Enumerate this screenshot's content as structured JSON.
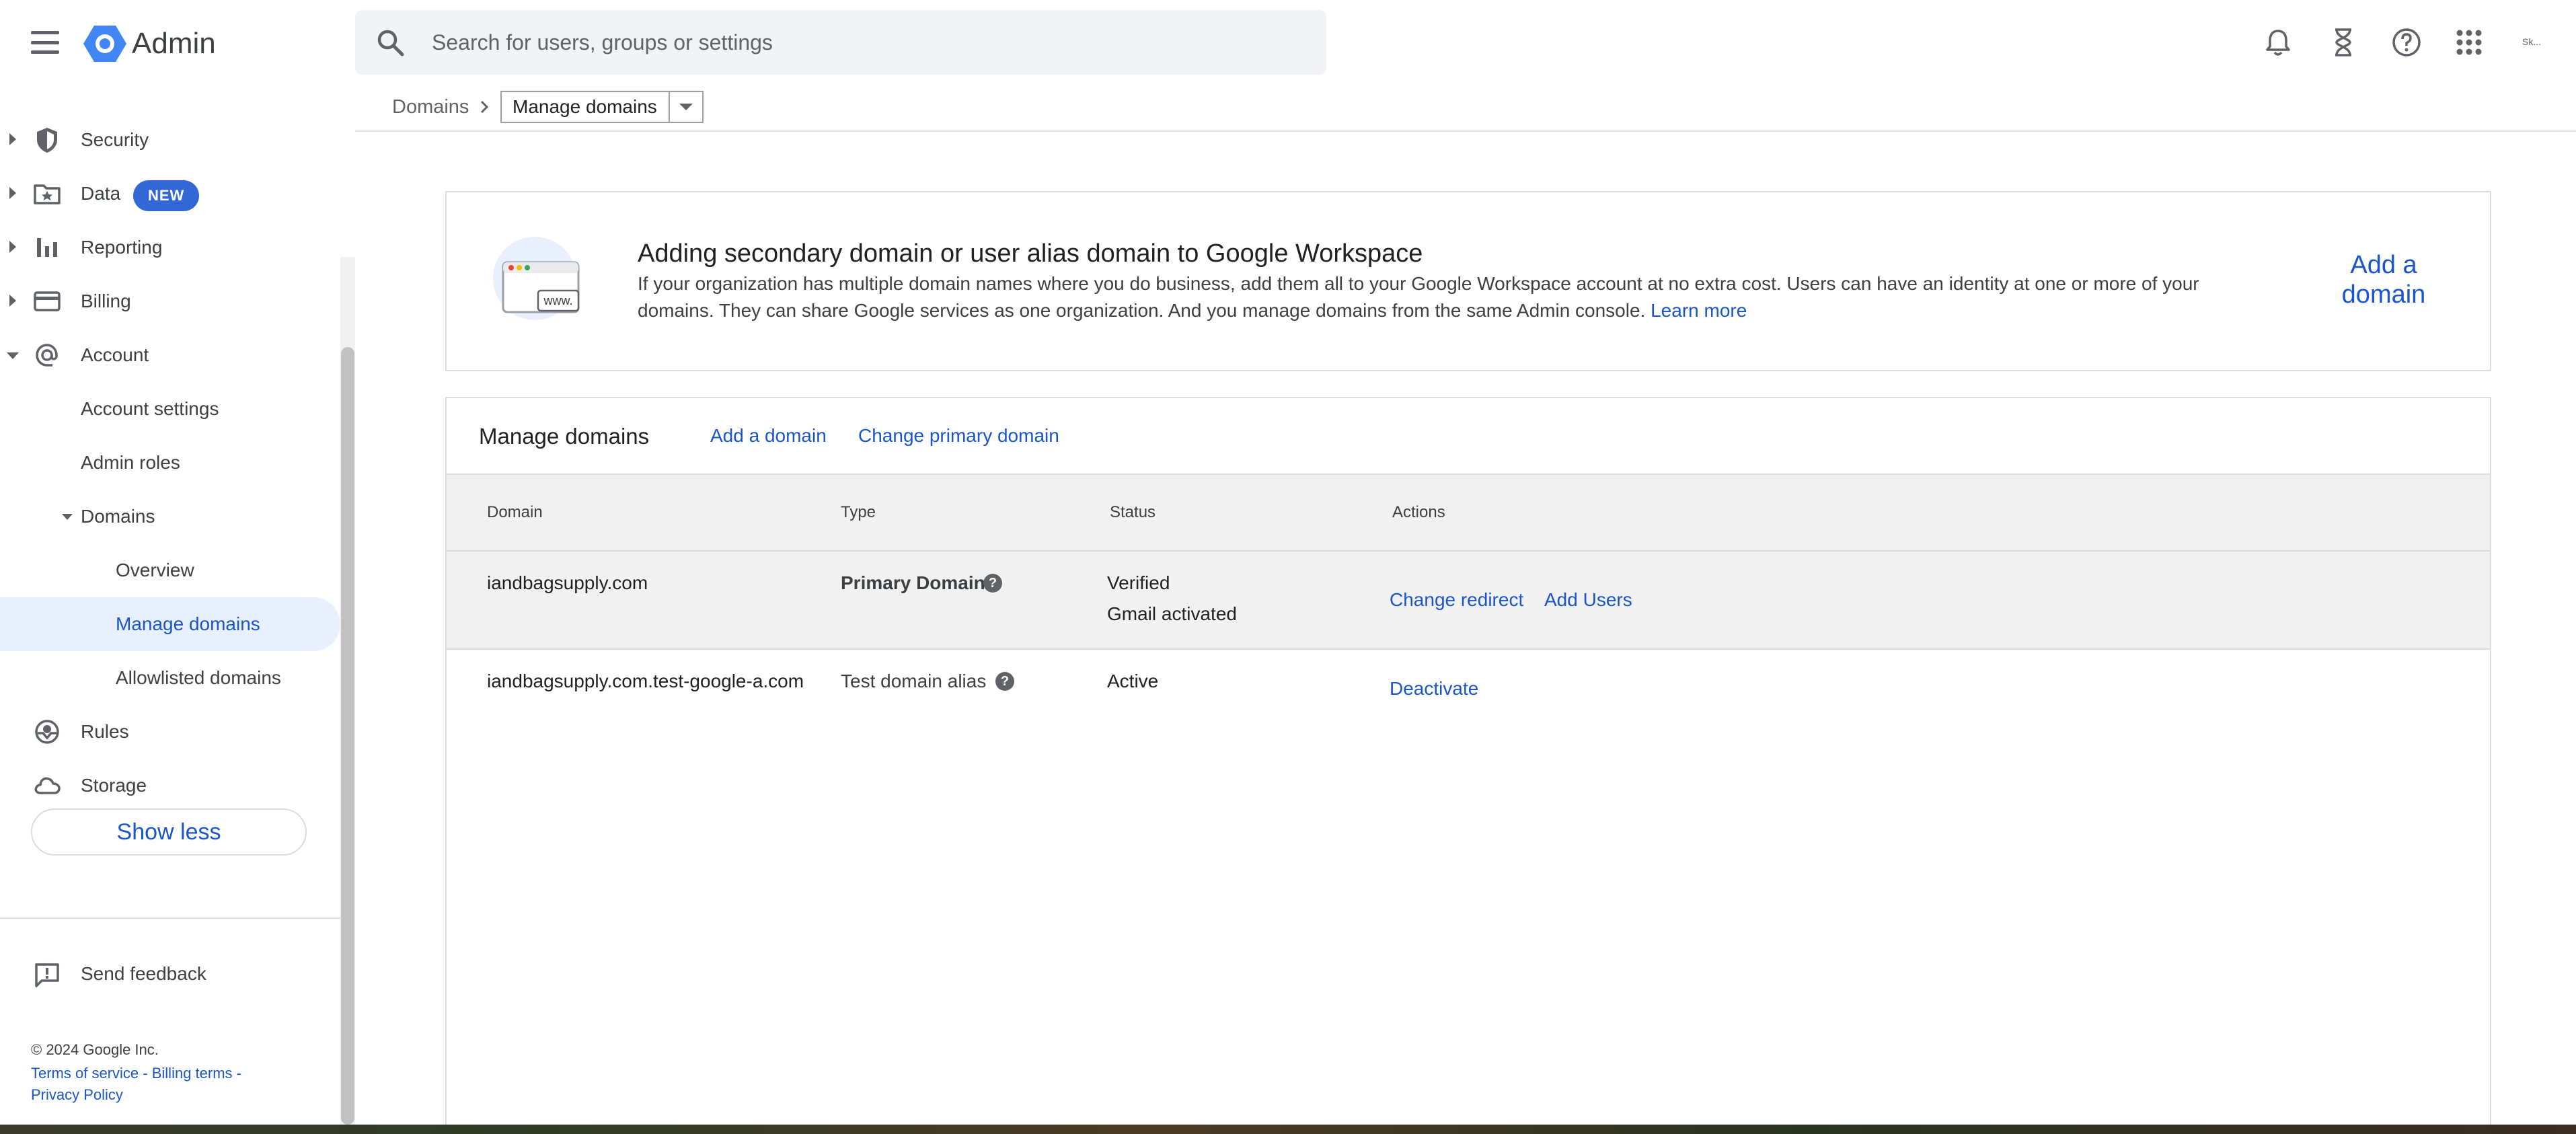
{
  "header": {
    "app_title": "Admin",
    "search_placeholder": "Search for users, groups or settings",
    "icons": [
      "menu-icon",
      "admin-logo",
      "search-icon",
      "notifications-icon",
      "tasks-hourglass-icon",
      "help-icon",
      "apps-grid-icon",
      "account-avatar"
    ],
    "avatar_text": "Sk..."
  },
  "breadcrumb": {
    "parent": "Domains",
    "current": "Manage domains"
  },
  "sidebar": {
    "items": [
      {
        "label": "Security",
        "icon": "shield-icon"
      },
      {
        "label": "Data",
        "icon": "folder-star-icon",
        "badge": "NEW"
      },
      {
        "label": "Reporting",
        "icon": "bar-chart-icon"
      },
      {
        "label": "Billing",
        "icon": "credit-card-icon"
      },
      {
        "label": "Account",
        "icon": "at-sign-icon"
      },
      {
        "label": "Account settings"
      },
      {
        "label": "Admin roles"
      },
      {
        "label": "Domains"
      },
      {
        "label": "Overview"
      },
      {
        "label": "Manage domains",
        "active": true
      },
      {
        "label": "Allowlisted domains"
      },
      {
        "label": "Rules",
        "icon": "rules-icon"
      },
      {
        "label": "Storage",
        "icon": "cloud-icon"
      }
    ],
    "show_less": "Show less",
    "send_feedback": "Send feedback",
    "copyright": "© 2024 Google Inc.",
    "footer_links": {
      "terms": "Terms of service",
      "billing": "Billing terms",
      "privacy": "Privacy Policy",
      "sep": "-"
    }
  },
  "info_card": {
    "title": "Adding secondary domain or user alias domain to Google Workspace",
    "body": "If your organization has multiple domain names where you do business, add them all to your Google Workspace account at no extra cost. Users can have an identity at one or more of your domains. They can share Google services as one organization. And you manage domains from the same Admin console.",
    "learn_more": "Learn more",
    "add_domain": "Add a domain",
    "illustration_text": "www."
  },
  "table": {
    "title": "Manage domains",
    "links": [
      "Add a domain",
      "Change primary domain"
    ],
    "columns": [
      "Domain",
      "Type",
      "Status",
      "Actions"
    ],
    "rows": [
      {
        "domain": "iandbagsupply.com",
        "type": "Primary Domain",
        "status": [
          "Verified",
          "Gmail activated"
        ],
        "actions": [
          "Change redirect",
          "Add Users"
        ]
      },
      {
        "domain": "iandbagsupply.com.test-google-a.com",
        "type": "Test domain alias",
        "status": [
          "Active"
        ],
        "actions": [
          "Deactivate"
        ]
      }
    ],
    "help_glyph": "?"
  },
  "colors": {
    "accent": "#1a56c9",
    "badge": "#3367d6",
    "active_bg": "#e8f0fe",
    "header_row_bg": "#f1f1f1"
  }
}
